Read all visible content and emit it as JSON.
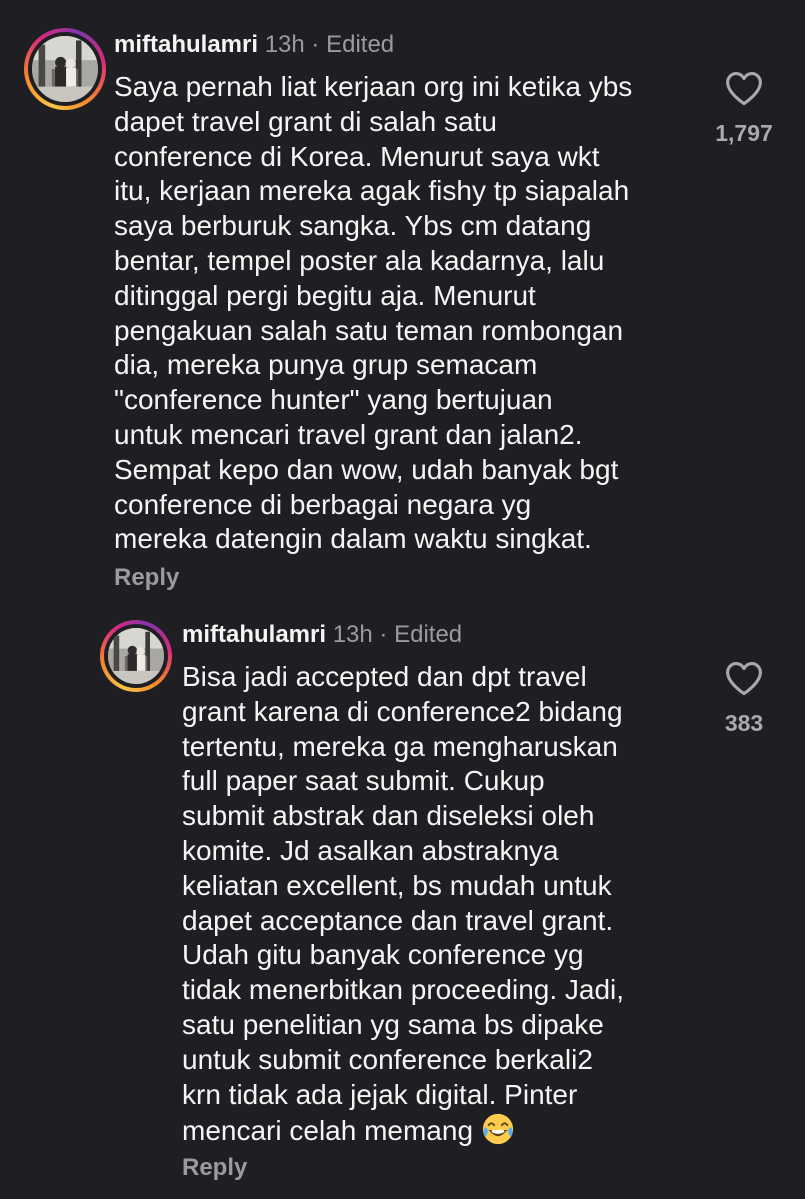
{
  "comments": [
    {
      "username": "miftahulamri",
      "time": "13h",
      "separator": "·",
      "edited": "Edited",
      "lines": [
        "Saya pernah liat kerjaan org ini ketika ybs",
        "dapet travel grant di salah satu",
        "conference di Korea. Menurut saya wkt",
        "itu, kerjaan mereka agak fishy tp siapalah",
        "saya berburuk sangka. Ybs cm datang",
        "bentar, tempel poster ala kadarnya, lalu",
        "ditinggal pergi begitu aja. Menurut",
        "pengakuan salah satu teman rombongan",
        "dia, mereka punya grup semacam",
        "\"conference hunter\" yang bertujuan",
        "untuk mencari travel grant dan jalan2.",
        "Sempat kepo dan wow, udah banyak bgt",
        "conference di berbagai negara yg",
        "mereka datengin dalam waktu singkat."
      ],
      "reply_label": "Reply",
      "like_icon": "heart-outline-icon",
      "like_count": "1,797"
    },
    {
      "username": "miftahulamri",
      "time": "13h",
      "separator": "·",
      "edited": "Edited",
      "lines": [
        "Bisa jadi accepted dan dpt travel",
        "grant karena di conference2 bidang",
        "tertentu, mereka ga mengharuskan",
        "full paper saat submit. Cukup",
        "submit abstrak dan diseleksi oleh",
        "komite. Jd asalkan abstraknya",
        "keliatan excellent, bs mudah untuk",
        "dapet acceptance dan travel grant.",
        "Udah gitu banyak conference yg",
        "tidak menerbitkan proceeding. Jadi,",
        "satu penelitian yg sama bs dipake",
        "untuk submit conference berkali2",
        "krn tidak ada jejak digital. Pinter",
        "mencari celah memang"
      ],
      "trailing_emoji": "face-with-tears-of-joy",
      "reply_label": "Reply",
      "like_icon": "heart-outline-icon",
      "like_count": "383"
    }
  ],
  "colors": {
    "background": "#1f1f23",
    "text": "#f5f5f5",
    "muted": "#9a9aa0"
  }
}
